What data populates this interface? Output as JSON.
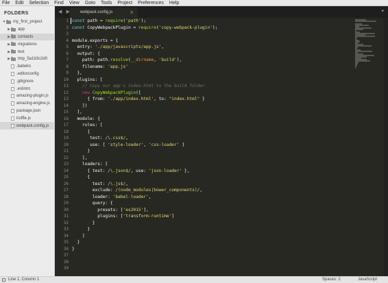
{
  "menu": [
    "File",
    "Edit",
    "Selection",
    "Find",
    "View",
    "Goto",
    "Tools",
    "Project",
    "Preferences",
    "Help"
  ],
  "sidebar": {
    "title": "FOLDERS",
    "items": [
      {
        "label": "my_first_project",
        "type": "folder",
        "depth": 0,
        "open": true
      },
      {
        "label": "app",
        "type": "folder",
        "depth": 1
      },
      {
        "label": "contacts",
        "type": "folder",
        "depth": 1,
        "active": true
      },
      {
        "label": "migrations",
        "type": "folder",
        "depth": 1
      },
      {
        "label": "test",
        "type": "folder",
        "depth": 1
      },
      {
        "label": "tmp_5a1b3c2d0",
        "type": "folder",
        "depth": 1
      },
      {
        "label": ".babelrc",
        "type": "file",
        "depth": 1
      },
      {
        "label": ".editorconfig",
        "type": "file",
        "depth": 1
      },
      {
        "label": ".gitignore",
        "type": "file",
        "depth": 1
      },
      {
        "label": ".eslintrc",
        "type": "file",
        "depth": 1
      },
      {
        "label": "amazing-plugin.js",
        "type": "file",
        "depth": 1
      },
      {
        "label": "amazing-engine.js",
        "type": "file",
        "depth": 1
      },
      {
        "label": "package.json",
        "type": "file",
        "depth": 1
      },
      {
        "label": "truffle.js",
        "type": "file",
        "depth": 1
      },
      {
        "label": "webpack.config.js",
        "type": "file",
        "depth": 1,
        "active": true
      }
    ]
  },
  "tabs": {
    "nav": "◀ ▶",
    "active_label": "webpack.config.js",
    "close": "×",
    "menu": "▾"
  },
  "editor": {
    "line_numbers": [
      "1",
      "2",
      "3",
      "4",
      "5",
      "6",
      "7",
      "8",
      "9",
      "10",
      "11",
      "12",
      "13",
      "14",
      "15",
      "16",
      "17",
      "18",
      "19",
      "20",
      "21",
      "22",
      "23",
      "24",
      "25",
      "26",
      "27",
      "28",
      "29",
      "30",
      "31",
      "32",
      "33",
      "34",
      "35",
      "36",
      "37",
      "38",
      "39"
    ],
    "lines": [
      [
        [
          "k",
          "const"
        ],
        [
          "t",
          " path = "
        ],
        [
          "f",
          "require"
        ],
        [
          "t",
          "("
        ],
        [
          "s",
          "'path'"
        ],
        [
          "t",
          ");"
        ]
      ],
      [
        [
          "k",
          "const"
        ],
        [
          "t",
          " CopyWebpackPlugin = "
        ],
        [
          "f",
          "require"
        ],
        [
          "t",
          "("
        ],
        [
          "s",
          "'copy-webpack-plugin'"
        ],
        [
          "t",
          ");"
        ]
      ],
      [
        [
          "t",
          ""
        ]
      ],
      [
        [
          "t",
          "module.exports = {"
        ]
      ],
      [
        [
          "t",
          "  entry: "
        ],
        [
          "s",
          "'./app/javascripts/app.js'"
        ],
        [
          "t",
          ","
        ]
      ],
      [
        [
          "t",
          "  output: {"
        ]
      ],
      [
        [
          "t",
          "    path: path."
        ],
        [
          "f",
          "resolve"
        ],
        [
          "t",
          "("
        ],
        [
          "p",
          "__dirname"
        ],
        [
          "t",
          ", "
        ],
        [
          "s",
          "'build'"
        ],
        [
          "t",
          "),"
        ]
      ],
      [
        [
          "t",
          "    filename: "
        ],
        [
          "s",
          "'app.js'"
        ]
      ],
      [
        [
          "t",
          "  },"
        ]
      ],
      [
        [
          "t",
          "  plugins: ["
        ]
      ],
      [
        [
          "c",
          "    // Copy our app's index.html to the build folder."
        ]
      ],
      [
        [
          "t",
          "    "
        ],
        [
          "kw",
          "new"
        ],
        [
          "t",
          " "
        ],
        [
          "f",
          "CopyWebpackPlugin"
        ],
        [
          "t",
          "(["
        ]
      ],
      [
        [
          "t",
          "      { from: "
        ],
        [
          "s",
          "'./app/index.html'"
        ],
        [
          "t",
          ", to: "
        ],
        [
          "s",
          "\"index.html\""
        ],
        [
          "t",
          " }"
        ]
      ],
      [
        [
          "t",
          "    ])"
        ]
      ],
      [
        [
          "t",
          "  ],"
        ]
      ],
      [
        [
          "t",
          "  module: {"
        ]
      ],
      [
        [
          "t",
          "    rules: ["
        ]
      ],
      [
        [
          "t",
          "      {"
        ]
      ],
      [
        [
          "t",
          "       test: "
        ],
        [
          "s",
          "/\\.css$/"
        ],
        [
          "t",
          ","
        ]
      ],
      [
        [
          "t",
          "       use: [ "
        ],
        [
          "s",
          "'style-loader'"
        ],
        [
          "t",
          ", "
        ],
        [
          "s",
          "'css-loader'"
        ],
        [
          "t",
          " ]"
        ]
      ],
      [
        [
          "t",
          "      }"
        ]
      ],
      [
        [
          "t",
          "    ],"
        ]
      ],
      [
        [
          "t",
          "    loaders: ["
        ]
      ],
      [
        [
          "t",
          "      { test: "
        ],
        [
          "s",
          "/\\.json$/"
        ],
        [
          "t",
          ", use: "
        ],
        [
          "s",
          "'json-loader'"
        ],
        [
          "t",
          " },"
        ]
      ],
      [
        [
          "t",
          "      {"
        ]
      ],
      [
        [
          "t",
          "        test: "
        ],
        [
          "s",
          "/\\.js$/"
        ],
        [
          "t",
          ","
        ]
      ],
      [
        [
          "t",
          "        exclude: "
        ],
        [
          "s",
          "/(node_modules|bower_components)/"
        ],
        [
          "t",
          ","
        ]
      ],
      [
        [
          "t",
          "        loader: "
        ],
        [
          "s",
          "'babel-loader'"
        ],
        [
          "t",
          ","
        ]
      ],
      [
        [
          "t",
          "        query: {"
        ]
      ],
      [
        [
          "t",
          "          presets: ["
        ],
        [
          "s",
          "'es2015'"
        ],
        [
          "t",
          "],"
        ]
      ],
      [
        [
          "t",
          "          plugins: ["
        ],
        [
          "s",
          "'transform-runtime'"
        ],
        [
          "t",
          "]"
        ]
      ],
      [
        [
          "t",
          "        }"
        ]
      ],
      [
        [
          "t",
          "      }"
        ]
      ],
      [
        [
          "t",
          "    ]"
        ]
      ],
      [
        [
          "t",
          "  }"
        ]
      ],
      [
        [
          "t",
          "}"
        ]
      ],
      [
        [
          "t",
          ""
        ]
      ],
      [
        [
          "t",
          ""
        ]
      ],
      [
        [
          "t",
          ""
        ]
      ]
    ]
  },
  "status": {
    "position": "Line 1, Column 1",
    "spaces": "Spaces: 2",
    "syntax": "JavaScript"
  },
  "colors": {
    "background": "#272822",
    "sidebar": "#ececec",
    "keyword": "#66d9ef",
    "string": "#e6db74",
    "function": "#a6e22e",
    "comment": "#75715e"
  }
}
